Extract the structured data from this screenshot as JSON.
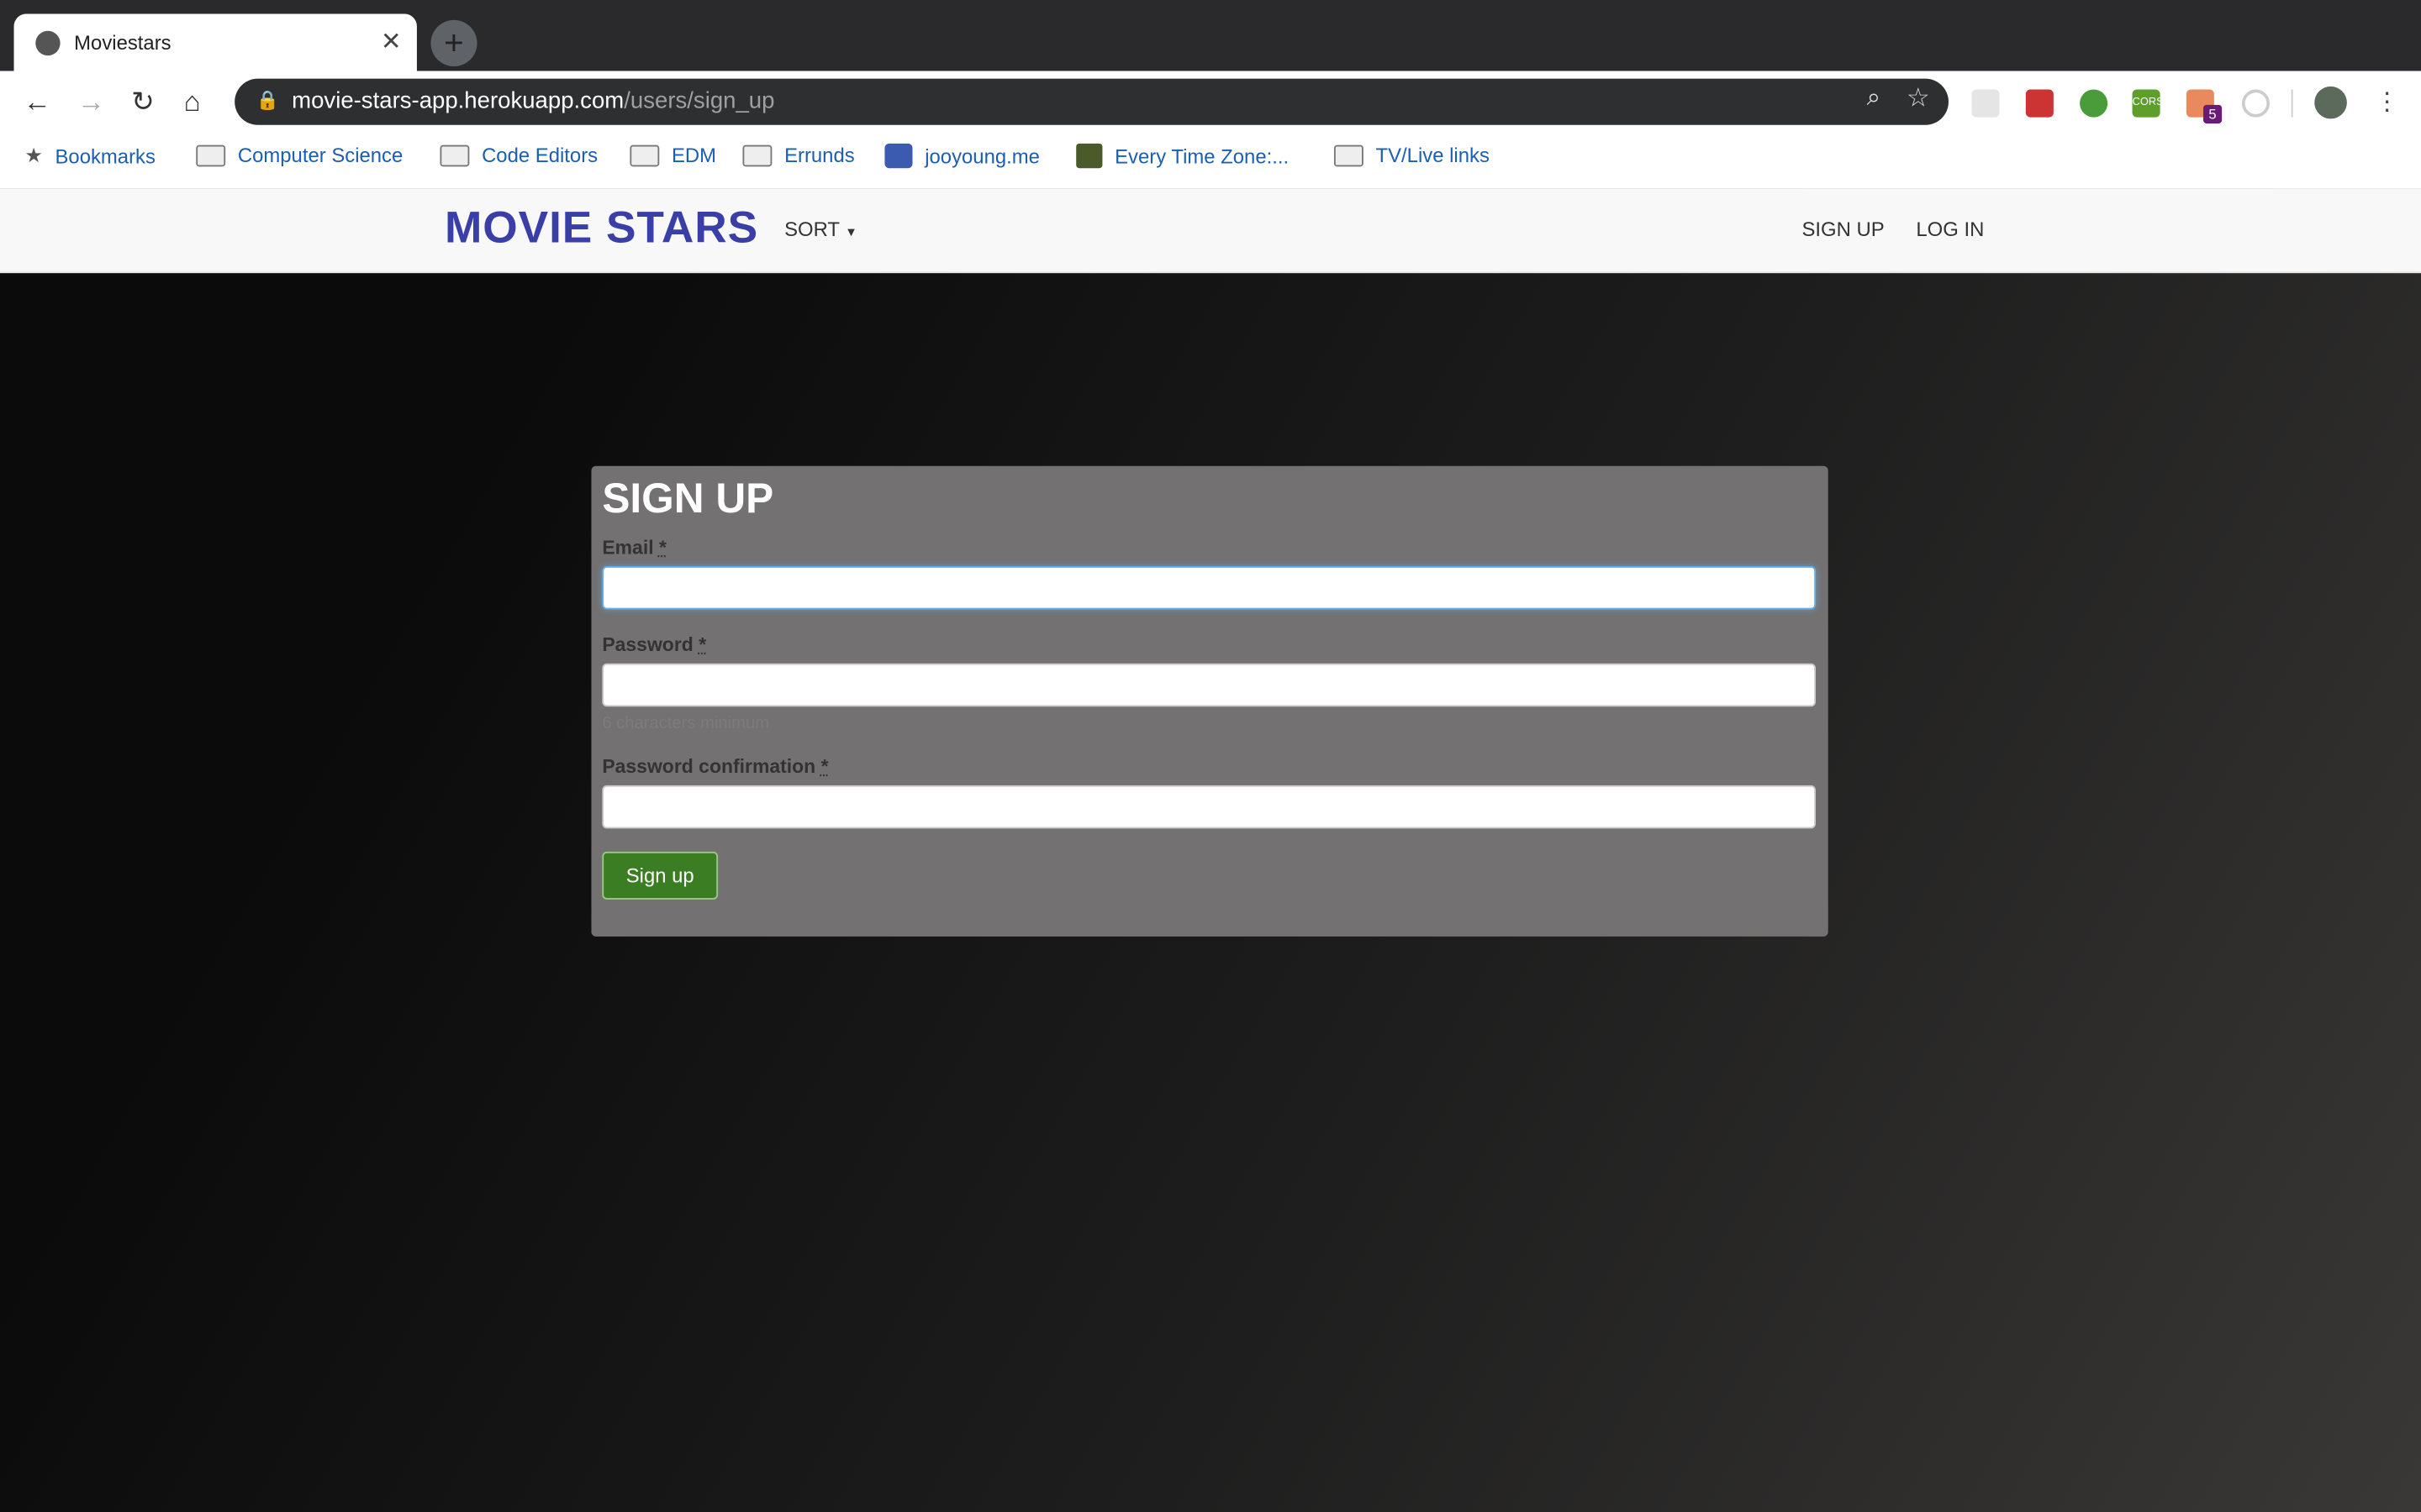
{
  "browser": {
    "tab_title": "Moviestars",
    "url_host": "movie-stars-app.herokuapp.com",
    "url_path": "/users/sign_up",
    "extension_badge": "5",
    "bookmarks": [
      "Bookmarks",
      "Computer Science",
      "Code Editors",
      "EDM",
      "Errunds",
      "jooyoung.me",
      "Every Time Zone:...",
      "TV/Live links"
    ]
  },
  "navbar": {
    "brand": "MOVIE STARS",
    "sort": "SORT",
    "sign_up": "SIGN UP",
    "log_in": "LOG IN"
  },
  "form": {
    "title": "SIGN UP",
    "email_label": "Email",
    "password_label": "Password",
    "password_hint": "6 characters minimum",
    "confirm_label": "Password confirmation",
    "required_mark": "*",
    "submit": "Sign up"
  },
  "colors": {
    "brand": "#3a3fa8",
    "button": "#3b7d23",
    "card": "#737171"
  }
}
